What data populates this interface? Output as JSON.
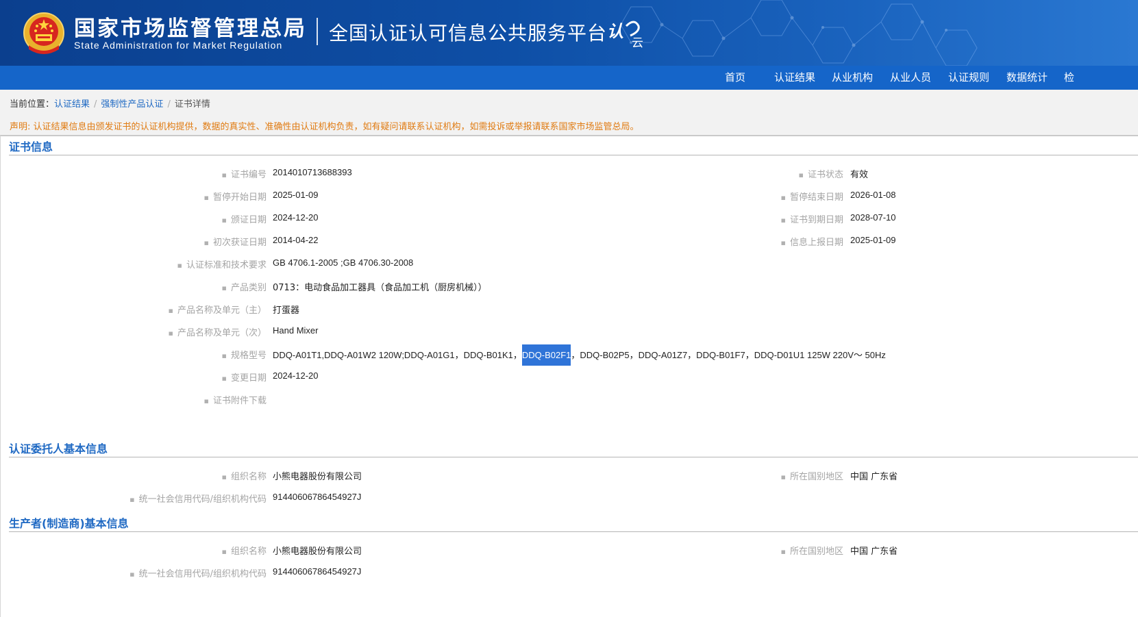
{
  "header": {
    "org_cn": "国家市场监督管理总局",
    "org_en": "State Administration  for  Market Regulation",
    "platform_title": "全国认证认可信息公共服务平台",
    "logo_text": "认云",
    "emblem_icon": "national-emblem-icon",
    "colors": {
      "banner": "#0e4fa6",
      "nav": "#1565c9",
      "accent": "#1f69c3",
      "notice": "#e07b12"
    }
  },
  "nav": {
    "items": [
      "首页",
      "认证结果",
      "从业机构",
      "从业人员",
      "认证规则",
      "数据统计",
      "检"
    ]
  },
  "breadcrumb": {
    "prefix": "当前位置：",
    "items": [
      "认证结果",
      "强制性产品认证",
      "证书详情"
    ],
    "separator": "/"
  },
  "notice": "声明: 认证结果信息由颁发证书的认证机构提供，数据的真实性、准确性由认证机构负责，如有疑问请联系认证机构，如需投诉或举报请联系国家市场监管总局。",
  "cert": {
    "section_title": "证书信息",
    "cert_no_label": "证书编号",
    "cert_no": "2014010713688393",
    "status_label": "证书状态",
    "status": "有效",
    "suspend_start_label": "暂停开始日期",
    "suspend_start": "2025-01-09",
    "suspend_end_label": "暂停结束日期",
    "suspend_end": "2026-01-08",
    "issue_date_label": "颁证日期",
    "issue_date": "2024-12-20",
    "expiry_label": "证书到期日期",
    "expiry": "2028-07-10",
    "first_date_label": "初次获证日期",
    "first_date": "2014-04-22",
    "report_date_label": "信息上报日期",
    "report_date": "2025-01-09",
    "standard_label": "认证标准和技术要求",
    "standard": "GB 4706.1-2005 ;GB 4706.30-2008",
    "category_label": "产品类别",
    "category": "0713：电动食品加工器具（食品加工机（厨房机械））",
    "product_main_label": "产品名称及单元（主）",
    "product_main": "打蛋器",
    "product_sub_label": "产品名称及单元（次）",
    "product_sub": "Hand Mixer",
    "model_label": "规格型号",
    "model_before": "DDQ-A01T1,DDQ-A01W2 120W;DDQ-A01G1，DDQ-B01K1，",
    "model_selected": "DDQ-B02F1",
    "model_after": "，DDQ-B02P5，DDQ-A01Z7，DDQ-B01F7，DDQ-D01U1 125W 220V～ 50Hz",
    "change_date_label": "变更日期",
    "change_date": "2024-12-20",
    "attachment_label": "证书附件下载"
  },
  "client": {
    "section_title": "认证委托人基本信息",
    "org_name_label": "组织名称",
    "org_name": "小熊电器股份有限公司",
    "region_label": "所在国别地区",
    "region": "中国 广东省",
    "credit_code_label": "统一社会信用代码/组织机构代码",
    "credit_code": "91440606786454927J"
  },
  "manufacturer": {
    "section_title": "生产者(制造商)基本信息",
    "org_name_label": "组织名称",
    "org_name": "小熊电器股份有限公司",
    "region_label": "所在国别地区",
    "region": "中国 广东省",
    "credit_code_label": "统一社会信用代码/组织机构代码",
    "credit_code": "91440606786454927J"
  }
}
